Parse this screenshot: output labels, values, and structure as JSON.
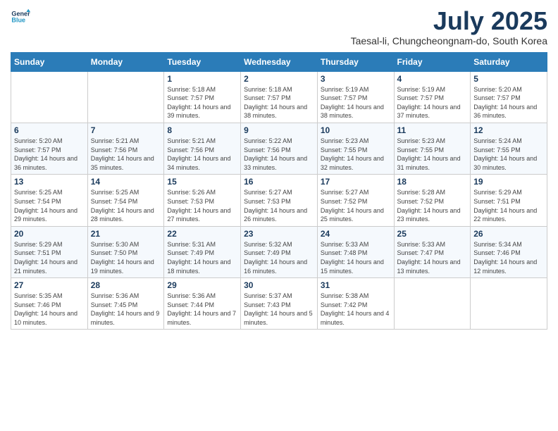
{
  "header": {
    "logo_line1": "General",
    "logo_line2": "Blue",
    "month_year": "July 2025",
    "location": "Taesal-li, Chungcheongnam-do, South Korea"
  },
  "weekdays": [
    "Sunday",
    "Monday",
    "Tuesday",
    "Wednesday",
    "Thursday",
    "Friday",
    "Saturday"
  ],
  "weeks": [
    [
      {
        "day": "",
        "sunrise": "",
        "sunset": "",
        "daylight": ""
      },
      {
        "day": "",
        "sunrise": "",
        "sunset": "",
        "daylight": ""
      },
      {
        "day": "1",
        "sunrise": "Sunrise: 5:18 AM",
        "sunset": "Sunset: 7:57 PM",
        "daylight": "Daylight: 14 hours and 39 minutes."
      },
      {
        "day": "2",
        "sunrise": "Sunrise: 5:18 AM",
        "sunset": "Sunset: 7:57 PM",
        "daylight": "Daylight: 14 hours and 38 minutes."
      },
      {
        "day": "3",
        "sunrise": "Sunrise: 5:19 AM",
        "sunset": "Sunset: 7:57 PM",
        "daylight": "Daylight: 14 hours and 38 minutes."
      },
      {
        "day": "4",
        "sunrise": "Sunrise: 5:19 AM",
        "sunset": "Sunset: 7:57 PM",
        "daylight": "Daylight: 14 hours and 37 minutes."
      },
      {
        "day": "5",
        "sunrise": "Sunrise: 5:20 AM",
        "sunset": "Sunset: 7:57 PM",
        "daylight": "Daylight: 14 hours and 36 minutes."
      }
    ],
    [
      {
        "day": "6",
        "sunrise": "Sunrise: 5:20 AM",
        "sunset": "Sunset: 7:57 PM",
        "daylight": "Daylight: 14 hours and 36 minutes."
      },
      {
        "day": "7",
        "sunrise": "Sunrise: 5:21 AM",
        "sunset": "Sunset: 7:56 PM",
        "daylight": "Daylight: 14 hours and 35 minutes."
      },
      {
        "day": "8",
        "sunrise": "Sunrise: 5:21 AM",
        "sunset": "Sunset: 7:56 PM",
        "daylight": "Daylight: 14 hours and 34 minutes."
      },
      {
        "day": "9",
        "sunrise": "Sunrise: 5:22 AM",
        "sunset": "Sunset: 7:56 PM",
        "daylight": "Daylight: 14 hours and 33 minutes."
      },
      {
        "day": "10",
        "sunrise": "Sunrise: 5:23 AM",
        "sunset": "Sunset: 7:55 PM",
        "daylight": "Daylight: 14 hours and 32 minutes."
      },
      {
        "day": "11",
        "sunrise": "Sunrise: 5:23 AM",
        "sunset": "Sunset: 7:55 PM",
        "daylight": "Daylight: 14 hours and 31 minutes."
      },
      {
        "day": "12",
        "sunrise": "Sunrise: 5:24 AM",
        "sunset": "Sunset: 7:55 PM",
        "daylight": "Daylight: 14 hours and 30 minutes."
      }
    ],
    [
      {
        "day": "13",
        "sunrise": "Sunrise: 5:25 AM",
        "sunset": "Sunset: 7:54 PM",
        "daylight": "Daylight: 14 hours and 29 minutes."
      },
      {
        "day": "14",
        "sunrise": "Sunrise: 5:25 AM",
        "sunset": "Sunset: 7:54 PM",
        "daylight": "Daylight: 14 hours and 28 minutes."
      },
      {
        "day": "15",
        "sunrise": "Sunrise: 5:26 AM",
        "sunset": "Sunset: 7:53 PM",
        "daylight": "Daylight: 14 hours and 27 minutes."
      },
      {
        "day": "16",
        "sunrise": "Sunrise: 5:27 AM",
        "sunset": "Sunset: 7:53 PM",
        "daylight": "Daylight: 14 hours and 26 minutes."
      },
      {
        "day": "17",
        "sunrise": "Sunrise: 5:27 AM",
        "sunset": "Sunset: 7:52 PM",
        "daylight": "Daylight: 14 hours and 25 minutes."
      },
      {
        "day": "18",
        "sunrise": "Sunrise: 5:28 AM",
        "sunset": "Sunset: 7:52 PM",
        "daylight": "Daylight: 14 hours and 23 minutes."
      },
      {
        "day": "19",
        "sunrise": "Sunrise: 5:29 AM",
        "sunset": "Sunset: 7:51 PM",
        "daylight": "Daylight: 14 hours and 22 minutes."
      }
    ],
    [
      {
        "day": "20",
        "sunrise": "Sunrise: 5:29 AM",
        "sunset": "Sunset: 7:51 PM",
        "daylight": "Daylight: 14 hours and 21 minutes."
      },
      {
        "day": "21",
        "sunrise": "Sunrise: 5:30 AM",
        "sunset": "Sunset: 7:50 PM",
        "daylight": "Daylight: 14 hours and 19 minutes."
      },
      {
        "day": "22",
        "sunrise": "Sunrise: 5:31 AM",
        "sunset": "Sunset: 7:49 PM",
        "daylight": "Daylight: 14 hours and 18 minutes."
      },
      {
        "day": "23",
        "sunrise": "Sunrise: 5:32 AM",
        "sunset": "Sunset: 7:49 PM",
        "daylight": "Daylight: 14 hours and 16 minutes."
      },
      {
        "day": "24",
        "sunrise": "Sunrise: 5:33 AM",
        "sunset": "Sunset: 7:48 PM",
        "daylight": "Daylight: 14 hours and 15 minutes."
      },
      {
        "day": "25",
        "sunrise": "Sunrise: 5:33 AM",
        "sunset": "Sunset: 7:47 PM",
        "daylight": "Daylight: 14 hours and 13 minutes."
      },
      {
        "day": "26",
        "sunrise": "Sunrise: 5:34 AM",
        "sunset": "Sunset: 7:46 PM",
        "daylight": "Daylight: 14 hours and 12 minutes."
      }
    ],
    [
      {
        "day": "27",
        "sunrise": "Sunrise: 5:35 AM",
        "sunset": "Sunset: 7:46 PM",
        "daylight": "Daylight: 14 hours and 10 minutes."
      },
      {
        "day": "28",
        "sunrise": "Sunrise: 5:36 AM",
        "sunset": "Sunset: 7:45 PM",
        "daylight": "Daylight: 14 hours and 9 minutes."
      },
      {
        "day": "29",
        "sunrise": "Sunrise: 5:36 AM",
        "sunset": "Sunset: 7:44 PM",
        "daylight": "Daylight: 14 hours and 7 minutes."
      },
      {
        "day": "30",
        "sunrise": "Sunrise: 5:37 AM",
        "sunset": "Sunset: 7:43 PM",
        "daylight": "Daylight: 14 hours and 5 minutes."
      },
      {
        "day": "31",
        "sunrise": "Sunrise: 5:38 AM",
        "sunset": "Sunset: 7:42 PM",
        "daylight": "Daylight: 14 hours and 4 minutes."
      },
      {
        "day": "",
        "sunrise": "",
        "sunset": "",
        "daylight": ""
      },
      {
        "day": "",
        "sunrise": "",
        "sunset": "",
        "daylight": ""
      }
    ]
  ]
}
